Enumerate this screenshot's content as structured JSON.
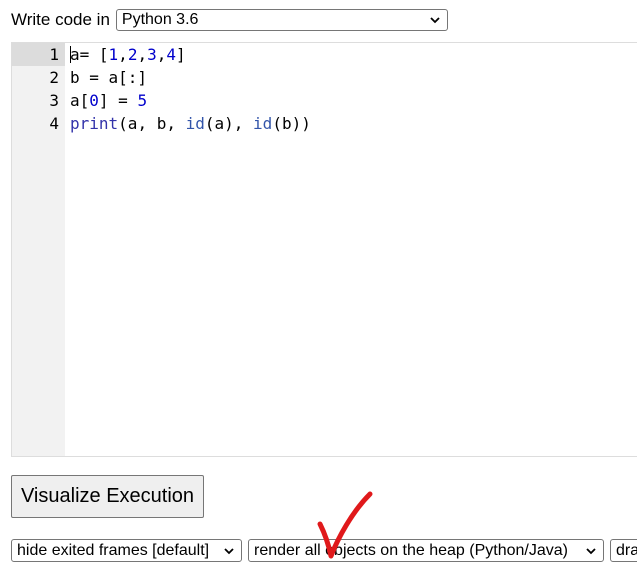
{
  "header": {
    "write_code_label": "Write code in",
    "language_select": {
      "selected": "Python 3.6"
    }
  },
  "editor": {
    "line_numbers": [
      "1",
      "2",
      "3",
      "4"
    ],
    "active_line": 1
  },
  "visualize_button": {
    "label": "Visualize Execution"
  },
  "options": {
    "frames_select": {
      "selected": "hide exited frames [default]"
    },
    "heap_select": {
      "selected": "render all objects on the heap (Python/Java)"
    },
    "draw_select": {
      "selected": "dra"
    }
  },
  "annotation": {
    "checkmark_color": "#e0191b"
  },
  "icons": {
    "dropdown": "chevron-down-icon",
    "annotation": "red-checkmark-icon"
  }
}
